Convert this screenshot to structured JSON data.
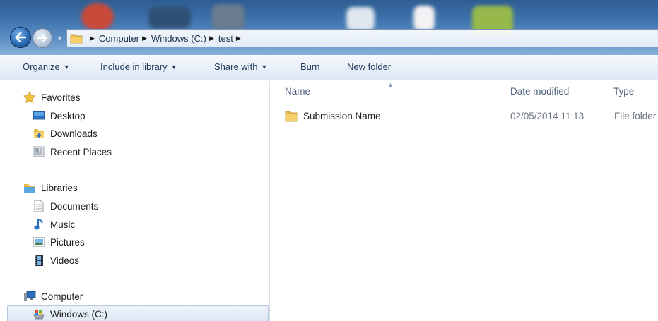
{
  "address": {
    "breadcrumbs": [
      "Computer",
      "Windows (C:)",
      "test"
    ]
  },
  "toolbar": {
    "organize": "Organize",
    "include_in_library": "Include in library",
    "share_with": "Share with",
    "burn": "Burn",
    "new_folder": "New folder"
  },
  "nav": {
    "favorites": {
      "header": "Favorites",
      "items": [
        "Desktop",
        "Downloads",
        "Recent Places"
      ]
    },
    "libraries": {
      "header": "Libraries",
      "items": [
        "Documents",
        "Music",
        "Pictures",
        "Videos"
      ]
    },
    "computer": {
      "header": "Computer",
      "items": [
        "Windows (C:)"
      ]
    }
  },
  "columns": {
    "name": "Name",
    "date_modified": "Date modified",
    "type": "Type"
  },
  "files": [
    {
      "name": "Submission Name",
      "date_modified": "02/05/2014 11:13",
      "type": "File folder"
    }
  ],
  "colors": {
    "accent": "#3e73ad",
    "toolbar_text": "#1e395b",
    "folder": "#e8b84a"
  }
}
